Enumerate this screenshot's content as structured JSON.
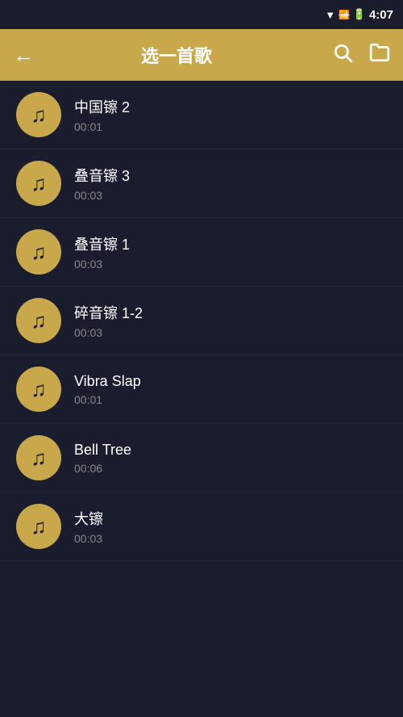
{
  "statusBar": {
    "time": "4:07",
    "icons": [
      "wifi",
      "signal-off",
      "battery"
    ]
  },
  "toolbar": {
    "backLabel": "←",
    "title": "选一首歌",
    "searchIconLabel": "🔍",
    "folderIconLabel": "📁"
  },
  "songs": [
    {
      "id": 1,
      "name": "中国镲 2",
      "duration": "00:01"
    },
    {
      "id": 2,
      "name": "叠音镲 3",
      "duration": "00:03"
    },
    {
      "id": 3,
      "name": "叠音镲 1",
      "duration": "00:03"
    },
    {
      "id": 4,
      "name": "碎音镲 1-2",
      "duration": "00:03"
    },
    {
      "id": 5,
      "name": "Vibra Slap",
      "duration": "00:01"
    },
    {
      "id": 6,
      "name": "Bell Tree",
      "duration": "00:06"
    },
    {
      "id": 7,
      "name": "大镲",
      "duration": "00:03"
    }
  ],
  "colors": {
    "background": "#1a1d2e",
    "accent": "#c9a84c",
    "text": "#ffffff",
    "subtext": "#888888"
  }
}
